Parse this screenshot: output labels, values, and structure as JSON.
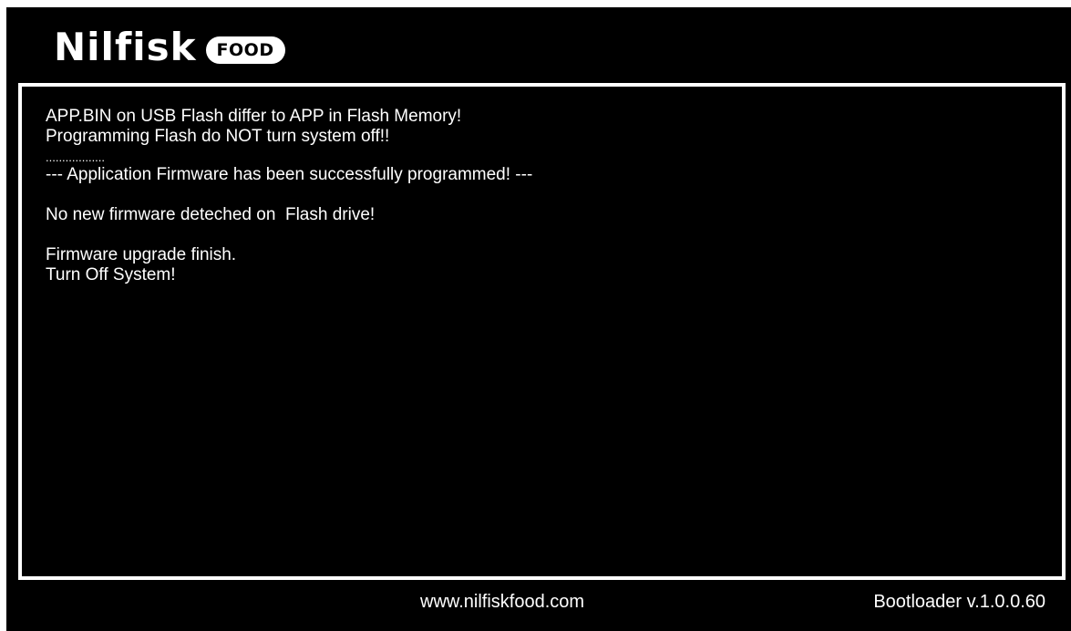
{
  "brand": {
    "name": "Nilfisk",
    "badge": "FOOD"
  },
  "console": {
    "lines": [
      "APP.BIN on USB Flash differ to APP in Flash Memory!",
      "Programming Flash do NOT turn system off!!",
      "..................",
      "--- Application Firmware has been successfully programmed! ---",
      "",
      "No new firmware deteched on  Flash drive!",
      "",
      "Firmware upgrade finish.",
      "Turn Off System!"
    ]
  },
  "footer": {
    "url": "www.nilfiskfood.com",
    "version": "Bootloader v.1.0.0.60"
  },
  "colors": {
    "background": "#000000",
    "foreground": "#ffffff"
  }
}
